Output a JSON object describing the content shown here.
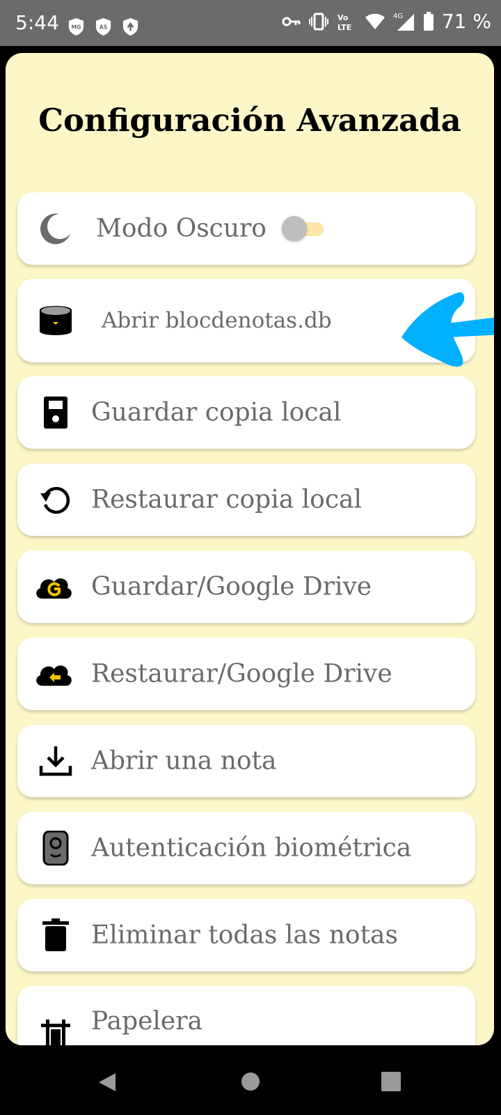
{
  "status_bar": {
    "time": "5:44",
    "left_badges": [
      "MG",
      "AS"
    ],
    "battery_percent": "71 %",
    "icons": [
      "mg-shield-icon",
      "as-shield-icon",
      "vpn-shield-icon",
      "key-icon",
      "vibrate-icon",
      "volte-icon",
      "wifi-icon",
      "signal-4g-icon",
      "battery-icon"
    ]
  },
  "page": {
    "title": "Configuración Avanzada"
  },
  "settings": {
    "items": [
      {
        "label": "Modo Oscuro",
        "icon": "moon-icon",
        "toggle_on": false
      },
      {
        "label": "Abrir blocdenotas.db",
        "icon": "database-icon"
      },
      {
        "label": "Guardar copia local",
        "icon": "save-icon"
      },
      {
        "label": "Restaurar copia local",
        "icon": "restore-icon"
      },
      {
        "label": "Guardar/Google Drive",
        "icon": "google-cloud-icon"
      },
      {
        "label": "Restaurar/Google Drive",
        "icon": "cloud-restore-icon"
      },
      {
        "label": "Abrir una nota",
        "icon": "download-icon"
      },
      {
        "label": "Autenticación biométrica",
        "icon": "biometric-icon"
      },
      {
        "label": "Eliminar todas las notas",
        "icon": "trash-icon"
      },
      {
        "label": "Papelera",
        "icon": "trash-bin-icon"
      }
    ]
  },
  "annotation": {
    "icon": "blue-arrow-annotation"
  },
  "colors": {
    "background": "#fdf7c8",
    "accent": "#f5c400",
    "arrow": "#00b0ff"
  },
  "nav_bar": {
    "icons": [
      "back-icon",
      "home-icon",
      "recents-icon"
    ]
  }
}
